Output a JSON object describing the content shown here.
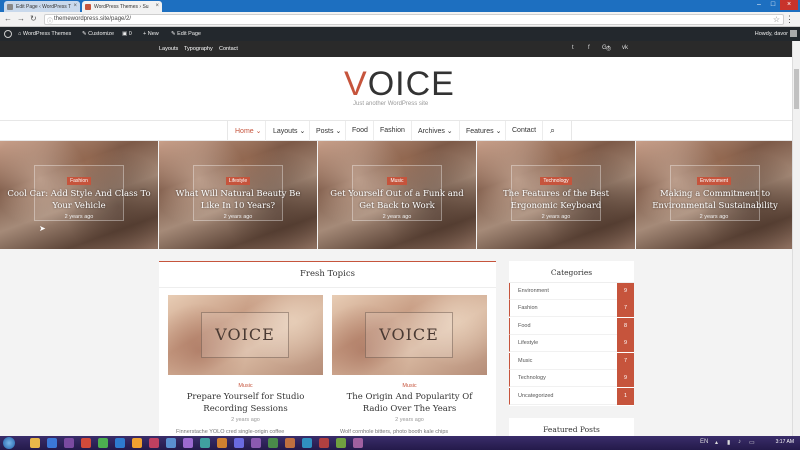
{
  "browser": {
    "tabs": [
      {
        "label": "Edit Page ‹ WordPress T",
        "active": false
      },
      {
        "label": "WordPress Themes › Su",
        "active": true
      }
    ],
    "url": "themewordpress.site/page/2/"
  },
  "admin_bar": {
    "site_name": "WordPress Themes",
    "customize": "Customize",
    "comments": "0",
    "new": "New",
    "edit_page": "Edit Page",
    "howdy": "Howdy, davor"
  },
  "topbar": {
    "links": [
      "Layouts",
      "Typography",
      "Contact"
    ],
    "social_icons": [
      "twitter-icon",
      "facebook-icon",
      "google-plus-icon",
      "instagram-icon",
      "vk-icon"
    ],
    "social_glyphs": [
      "t",
      "f",
      "G+",
      "◎",
      "vk"
    ]
  },
  "header": {
    "logo_first": "V",
    "logo_rest": "OICE",
    "tagline": "Just another WordPress site"
  },
  "nav": {
    "items": [
      {
        "label": "Home ⌄",
        "active": true
      },
      {
        "label": "Layouts ⌄",
        "active": false
      },
      {
        "label": "Posts ⌄",
        "active": false
      },
      {
        "label": "Food",
        "active": false
      },
      {
        "label": "Fashion",
        "active": false
      },
      {
        "label": "Archives ⌄",
        "active": false
      },
      {
        "label": "Features ⌄",
        "active": false
      },
      {
        "label": "Contact",
        "active": false
      }
    ],
    "search_glyph": "⌕"
  },
  "slider": [
    {
      "category": "Fashion",
      "title": "Cool Car: Add Style And Class To Your Vehicle",
      "date": "2 years ago"
    },
    {
      "category": "Lifestyle",
      "title": "What Will Natural Beauty Be Like In 10 Years?",
      "date": "2 years ago"
    },
    {
      "category": "Music",
      "title": "Get Yourself Out of a Funk and Get Back to Work",
      "date": "2 years ago"
    },
    {
      "category": "Technology",
      "title": "The Features of the Best Ergonomic Keyboard",
      "date": "2 years ago"
    },
    {
      "category": "Environment",
      "title": "Making a Commitment to Environmental Sustainability",
      "date": "2 years ago"
    }
  ],
  "fresh_topics": {
    "title": "Fresh Topics",
    "cards": [
      {
        "thumb_text": "VOICE",
        "category": "Music",
        "title": "Prepare Yourself for Studio Recording Sessions",
        "date": "2 years ago",
        "excerpt": "Finnerstache YOLO cred single-origin coffee"
      },
      {
        "thumb_text": "VOICE",
        "category": "Music",
        "title": "The Origin And Popularity Of Radio Over The Years",
        "date": "2 years ago",
        "excerpt": "Wolf cornhole bitters, photo booth kale chips"
      }
    ]
  },
  "sidebar": {
    "categories_title": "Categories",
    "categories": [
      {
        "name": "Environment",
        "count": "9"
      },
      {
        "name": "Fashion",
        "count": "7"
      },
      {
        "name": "Food",
        "count": "8"
      },
      {
        "name": "Lifestyle",
        "count": "9"
      },
      {
        "name": "Music",
        "count": "7"
      },
      {
        "name": "Technology",
        "count": "9"
      },
      {
        "name": "Uncategorized",
        "count": "1"
      }
    ],
    "featured_title": "Featured Posts"
  },
  "taskbar": {
    "lang": "EN",
    "time": "3:17 AM"
  },
  "colors": {
    "accent": "#c6543c",
    "admin_bar": "#23282d",
    "topbar": "#2a2a2a"
  }
}
